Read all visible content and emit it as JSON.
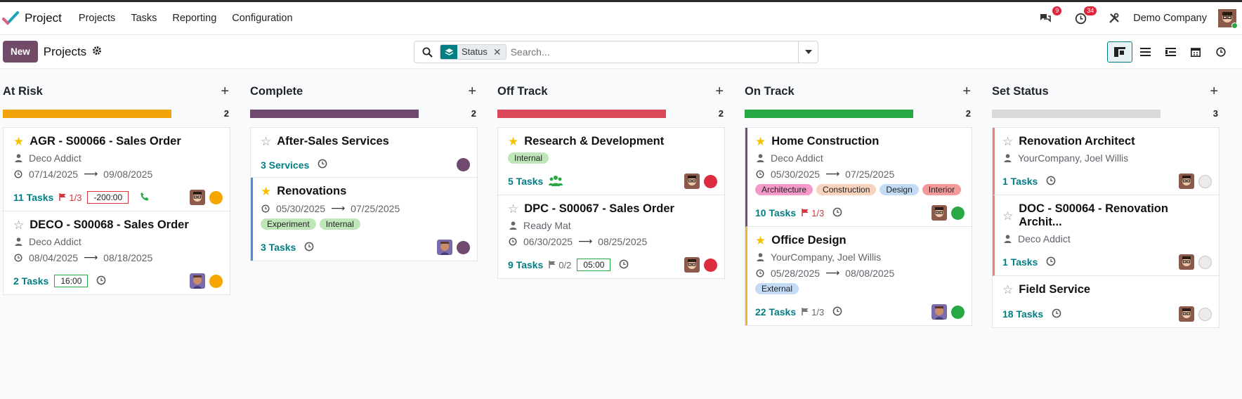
{
  "nav": {
    "app_name": "Project",
    "menu": [
      "Projects",
      "Tasks",
      "Reporting",
      "Configuration"
    ],
    "messages_count": "9",
    "activities_count": "34",
    "company": "Demo Company"
  },
  "control": {
    "new_label": "New",
    "title": "Projects",
    "facet_label": "Status",
    "facet_remove": "✕",
    "search_placeholder": "Search..."
  },
  "colors": {
    "at_risk": "#f0a30a",
    "complete": "#6f4a6e",
    "off_track": "#dc4a5a",
    "on_track": "#28a745",
    "set_status": "#d9d9d9",
    "brand": "#714b67",
    "teal": "#017e84"
  },
  "columns": [
    {
      "title": "At Risk",
      "count": "2",
      "progress": 1.0,
      "cards": [
        {
          "starred": true,
          "title": "AGR - S00066 - Sales Order",
          "customer": "Deco Addict",
          "date_start": "07/14/2025",
          "date_end": "09/08/2025",
          "tasks": "11 Tasks",
          "milestone": "1/3",
          "milestone_red": true,
          "time": "-200:00",
          "time_red": true,
          "phone": true,
          "status": "orange"
        },
        {
          "starred": false,
          "title": "DECO - S00068 - Sales Order",
          "customer": "Deco Addict",
          "date_start": "08/04/2025",
          "date_end": "08/18/2025",
          "tasks": "2 Tasks",
          "time": "16:00",
          "time_red": false,
          "clock": true,
          "status": "orange"
        }
      ]
    },
    {
      "title": "Complete",
      "count": "2",
      "progress": 1.0,
      "cards": [
        {
          "starred": false,
          "title": "After-Sales Services",
          "tasks": "3 Services",
          "clock": true,
          "status": "purple",
          "no_avatar": true
        },
        {
          "starred": true,
          "title": "Renovations",
          "date_start": "05/30/2025",
          "date_end": "07/25/2025",
          "tags": [
            {
              "label": "Experiment",
              "color": "#bfe6b9"
            },
            {
              "label": "Internal",
              "color": "#bfe6b9"
            }
          ],
          "tasks": "3 Tasks",
          "clock": true,
          "status": "purple",
          "leftbar": "#4c8ed9"
        }
      ]
    },
    {
      "title": "Off Track",
      "count": "2",
      "progress": 1.0,
      "cards": [
        {
          "starred": true,
          "title": "Research & Development",
          "tags": [
            {
              "label": "Internal",
              "color": "#bfe6b9"
            }
          ],
          "tasks": "5 Tasks",
          "team": true,
          "status": "red"
        },
        {
          "starred": false,
          "title": "DPC - S00067 - Sales Order",
          "customer": "Ready Mat",
          "date_start": "06/30/2025",
          "date_end": "08/25/2025",
          "tasks": "9 Tasks",
          "milestone": "0/2",
          "milestone_red": false,
          "time": "05:00",
          "time_red": false,
          "clock": true,
          "status": "red"
        }
      ]
    },
    {
      "title": "On Track",
      "count": "2",
      "progress": 1.0,
      "cards": [
        {
          "starred": true,
          "title": "Home Construction",
          "customer": "Deco Addict",
          "date_start": "05/30/2025",
          "date_end": "07/25/2025",
          "tags": [
            {
              "label": "Architecture",
              "color": "#f49ac8"
            },
            {
              "label": "Construction",
              "color": "#f8d3bd"
            },
            {
              "label": "Design",
              "color": "#c3dbf5"
            },
            {
              "label": "Interior",
              "color": "#f59a9a"
            }
          ],
          "tasks": "10 Tasks",
          "milestone": "1/3",
          "milestone_red": true,
          "clock": true,
          "status": "green",
          "leftbar": "#7a4a7a"
        },
        {
          "starred": true,
          "title": "Office Design",
          "customer": "YourCompany, Joel Willis",
          "date_start": "05/28/2025",
          "date_end": "08/08/2025",
          "tags": [
            {
              "label": "External",
              "color": "#c3dbf5"
            }
          ],
          "tasks": "22 Tasks",
          "milestone": "1/3",
          "milestone_red": false,
          "clock": true,
          "status": "green",
          "leftbar": "#f0b429",
          "face2": true
        }
      ]
    },
    {
      "title": "Set Status",
      "count": "3",
      "progress": 1.0,
      "cards": [
        {
          "starred": false,
          "title": "Renovation Architect",
          "customer": "YourCompany, Joel Willis",
          "tasks": "1 Tasks",
          "clock": true,
          "status": "grey",
          "leftbar": "#e8866a"
        },
        {
          "starred": false,
          "title": "DOC - S00064 - Renovation Archit...",
          "customer": "Deco Addict",
          "tasks": "1 Tasks",
          "clock": true,
          "status": "grey",
          "leftbar": "#e8866a"
        },
        {
          "starred": false,
          "title": "Field Service",
          "tasks": "18 Tasks",
          "clock": true,
          "status": "grey"
        }
      ]
    }
  ]
}
